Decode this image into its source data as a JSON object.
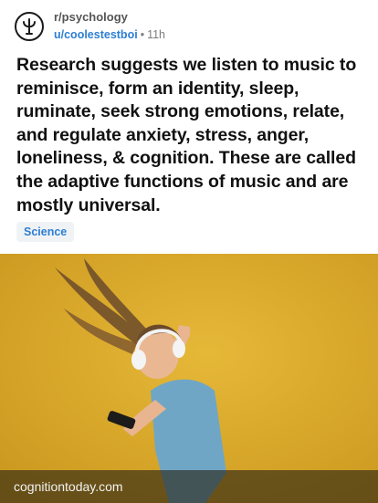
{
  "post": {
    "subreddit": "r/psychology",
    "author": "u/coolestestboi",
    "separator": "•",
    "age": "11h",
    "title": "Research suggests we listen to music to reminisce, form an identity, sleep, ruminate, seek strong emotions, relate, and regulate anxiety, stress, anger, loneliness, & cognition. These are called the adaptive functions of music and are mostly universal.",
    "flair": "Science",
    "link_domain": "cognitiontoday.com",
    "icon": "psi-icon"
  },
  "colors": {
    "accent": "#2d7fd3",
    "image_background": "#d8a928"
  }
}
